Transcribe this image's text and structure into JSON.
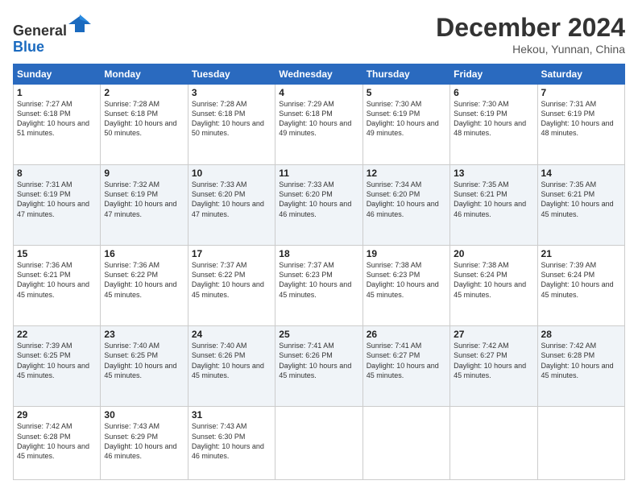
{
  "header": {
    "logo_line1": "General",
    "logo_line2": "Blue",
    "month_title": "December 2024",
    "location": "Hekou, Yunnan, China"
  },
  "weekdays": [
    "Sunday",
    "Monday",
    "Tuesday",
    "Wednesday",
    "Thursday",
    "Friday",
    "Saturday"
  ],
  "weeks": [
    [
      {
        "day": "1",
        "info": "Sunrise: 7:27 AM\nSunset: 6:18 PM\nDaylight: 10 hours\nand 51 minutes."
      },
      {
        "day": "2",
        "info": "Sunrise: 7:28 AM\nSunset: 6:18 PM\nDaylight: 10 hours\nand 50 minutes."
      },
      {
        "day": "3",
        "info": "Sunrise: 7:28 AM\nSunset: 6:18 PM\nDaylight: 10 hours\nand 50 minutes."
      },
      {
        "day": "4",
        "info": "Sunrise: 7:29 AM\nSunset: 6:18 PM\nDaylight: 10 hours\nand 49 minutes."
      },
      {
        "day": "5",
        "info": "Sunrise: 7:30 AM\nSunset: 6:19 PM\nDaylight: 10 hours\nand 49 minutes."
      },
      {
        "day": "6",
        "info": "Sunrise: 7:30 AM\nSunset: 6:19 PM\nDaylight: 10 hours\nand 48 minutes."
      },
      {
        "day": "7",
        "info": "Sunrise: 7:31 AM\nSunset: 6:19 PM\nDaylight: 10 hours\nand 48 minutes."
      }
    ],
    [
      {
        "day": "8",
        "info": "Sunrise: 7:31 AM\nSunset: 6:19 PM\nDaylight: 10 hours\nand 47 minutes."
      },
      {
        "day": "9",
        "info": "Sunrise: 7:32 AM\nSunset: 6:19 PM\nDaylight: 10 hours\nand 47 minutes."
      },
      {
        "day": "10",
        "info": "Sunrise: 7:33 AM\nSunset: 6:20 PM\nDaylight: 10 hours\nand 47 minutes."
      },
      {
        "day": "11",
        "info": "Sunrise: 7:33 AM\nSunset: 6:20 PM\nDaylight: 10 hours\nand 46 minutes."
      },
      {
        "day": "12",
        "info": "Sunrise: 7:34 AM\nSunset: 6:20 PM\nDaylight: 10 hours\nand 46 minutes."
      },
      {
        "day": "13",
        "info": "Sunrise: 7:35 AM\nSunset: 6:21 PM\nDaylight: 10 hours\nand 46 minutes."
      },
      {
        "day": "14",
        "info": "Sunrise: 7:35 AM\nSunset: 6:21 PM\nDaylight: 10 hours\nand 45 minutes."
      }
    ],
    [
      {
        "day": "15",
        "info": "Sunrise: 7:36 AM\nSunset: 6:21 PM\nDaylight: 10 hours\nand 45 minutes."
      },
      {
        "day": "16",
        "info": "Sunrise: 7:36 AM\nSunset: 6:22 PM\nDaylight: 10 hours\nand 45 minutes."
      },
      {
        "day": "17",
        "info": "Sunrise: 7:37 AM\nSunset: 6:22 PM\nDaylight: 10 hours\nand 45 minutes."
      },
      {
        "day": "18",
        "info": "Sunrise: 7:37 AM\nSunset: 6:23 PM\nDaylight: 10 hours\nand 45 minutes."
      },
      {
        "day": "19",
        "info": "Sunrise: 7:38 AM\nSunset: 6:23 PM\nDaylight: 10 hours\nand 45 minutes."
      },
      {
        "day": "20",
        "info": "Sunrise: 7:38 AM\nSunset: 6:24 PM\nDaylight: 10 hours\nand 45 minutes."
      },
      {
        "day": "21",
        "info": "Sunrise: 7:39 AM\nSunset: 6:24 PM\nDaylight: 10 hours\nand 45 minutes."
      }
    ],
    [
      {
        "day": "22",
        "info": "Sunrise: 7:39 AM\nSunset: 6:25 PM\nDaylight: 10 hours\nand 45 minutes."
      },
      {
        "day": "23",
        "info": "Sunrise: 7:40 AM\nSunset: 6:25 PM\nDaylight: 10 hours\nand 45 minutes."
      },
      {
        "day": "24",
        "info": "Sunrise: 7:40 AM\nSunset: 6:26 PM\nDaylight: 10 hours\nand 45 minutes."
      },
      {
        "day": "25",
        "info": "Sunrise: 7:41 AM\nSunset: 6:26 PM\nDaylight: 10 hours\nand 45 minutes."
      },
      {
        "day": "26",
        "info": "Sunrise: 7:41 AM\nSunset: 6:27 PM\nDaylight: 10 hours\nand 45 minutes."
      },
      {
        "day": "27",
        "info": "Sunrise: 7:42 AM\nSunset: 6:27 PM\nDaylight: 10 hours\nand 45 minutes."
      },
      {
        "day": "28",
        "info": "Sunrise: 7:42 AM\nSunset: 6:28 PM\nDaylight: 10 hours\nand 45 minutes."
      }
    ],
    [
      {
        "day": "29",
        "info": "Sunrise: 7:42 AM\nSunset: 6:28 PM\nDaylight: 10 hours\nand 45 minutes."
      },
      {
        "day": "30",
        "info": "Sunrise: 7:43 AM\nSunset: 6:29 PM\nDaylight: 10 hours\nand 46 minutes."
      },
      {
        "day": "31",
        "info": "Sunrise: 7:43 AM\nSunset: 6:30 PM\nDaylight: 10 hours\nand 46 minutes."
      },
      {
        "day": "",
        "info": ""
      },
      {
        "day": "",
        "info": ""
      },
      {
        "day": "",
        "info": ""
      },
      {
        "day": "",
        "info": ""
      }
    ]
  ]
}
